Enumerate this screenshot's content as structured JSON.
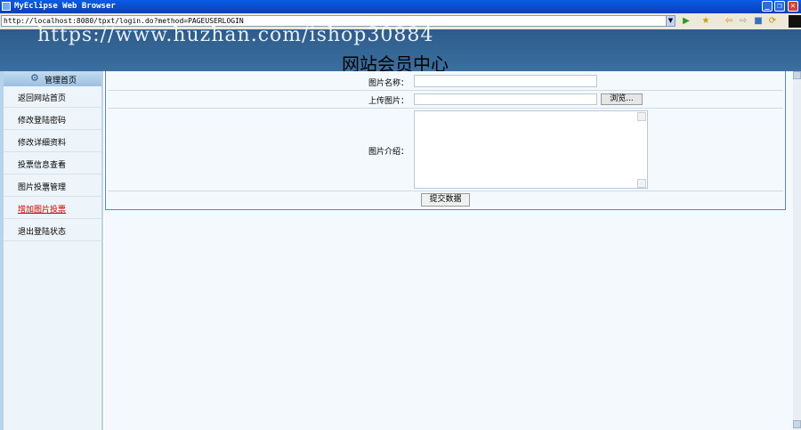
{
  "window": {
    "title": "MyEclipse Web Browser",
    "minimize": "_",
    "maximize": "❐",
    "close": "✕"
  },
  "address": {
    "url": "http://localhost:8080/tpxt/login.do?method=PAGEUSERLOGIN",
    "dropdown": "▼",
    "go": "▶"
  },
  "toolbar": {
    "star": "★",
    "back": "⇦",
    "forward": "⇨",
    "stop": "■",
    "refresh": "⟳"
  },
  "watermark": "https://www.huzhan.com/ishop30884",
  "site_title": "网站会员中心",
  "sidebar": {
    "header": "管理首页",
    "items": [
      {
        "label": "返回网站首页"
      },
      {
        "label": "修改登陆密码"
      },
      {
        "label": "修改详细资料"
      },
      {
        "label": "投票信息查看"
      },
      {
        "label": "图片投票管理"
      },
      {
        "label": "增加图片投票"
      },
      {
        "label": "退出登陆状态"
      }
    ]
  },
  "form": {
    "name_label": "图片名称：",
    "upload_label": "上传图片：",
    "browse_button": "浏览...",
    "intro_label": "图片介绍：",
    "submit_button": "提交数据"
  }
}
